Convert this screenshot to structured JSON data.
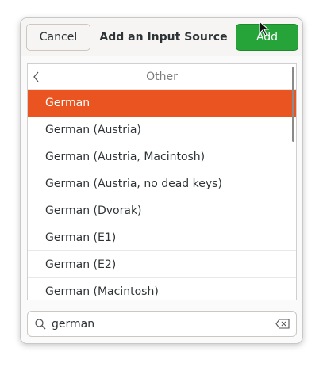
{
  "dialog": {
    "title": "Add an Input Source",
    "cancel_label": "Cancel",
    "add_label": "Add"
  },
  "list": {
    "header": "Other",
    "items": [
      {
        "label": "German",
        "selected": true
      },
      {
        "label": "German (Austria)",
        "selected": false
      },
      {
        "label": "German (Austria, Macintosh)",
        "selected": false
      },
      {
        "label": "German (Austria, no dead keys)",
        "selected": false
      },
      {
        "label": "German (Dvorak)",
        "selected": false
      },
      {
        "label": "German (E1)",
        "selected": false
      },
      {
        "label": "German (E2)",
        "selected": false
      },
      {
        "label": "German (Macintosh)",
        "selected": false
      }
    ]
  },
  "search": {
    "value": "german"
  },
  "colors": {
    "selected": "#e95420",
    "add_button": "#26a439"
  }
}
